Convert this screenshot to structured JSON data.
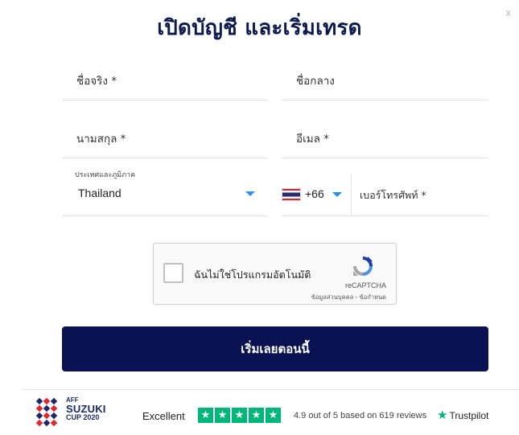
{
  "close_label": "x",
  "title": "เปิดบัญชี และเริ่มเทรด",
  "form": {
    "first_name": "ชื่อจริง *",
    "middle_name": "ชื่อกลาง",
    "last_name": "นามสกุล *",
    "email": "อีเมล *",
    "country_label": "ประเทศและภูมิภาค",
    "country_value": "Thailand",
    "dial_code": "+66",
    "phone": "เบอร์โทรศัพท์ *"
  },
  "recaptcha": {
    "label": "ฉันไม่ใช่โปรแกรมอัตโนมัติ",
    "brand": "reCAPTCHA",
    "links": "ข้อมูลส่วนบุคคล - ข้อกำหนด"
  },
  "cta_label": "เริ่มเลยตอนนี้",
  "footer": {
    "aff": "AFF",
    "suzuki": "SUZUKI",
    "cup": "CUP 2020",
    "tp_excellent": "Excellent",
    "tp_rating": "4.9 out of 5 based on 619 reviews",
    "tp_brand": "Trustpilot",
    "tp_star_glyph": "★",
    "tp_stars_count": 5
  },
  "colors": {
    "title": "#0d1a4f",
    "cta": "#0a1254",
    "caret": "#2f8ff0",
    "trustpilot_green": "#00b67a"
  }
}
